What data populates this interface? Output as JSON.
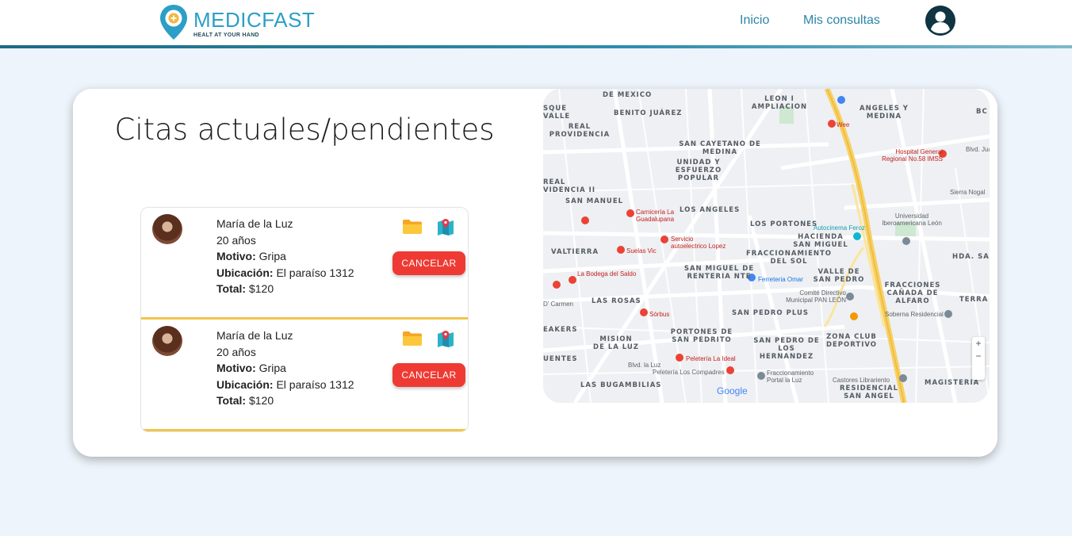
{
  "brand": {
    "name": "MEDICFAST",
    "tagline": "HEALT AT YOUR HAND",
    "accent": "#2b9fc6"
  },
  "nav": {
    "items": [
      {
        "label": "Inicio"
      },
      {
        "label": "Mis consultas"
      }
    ]
  },
  "page": {
    "title": "Citas actuales/pendientes"
  },
  "appointments": [
    {
      "name": "María de la Luz",
      "age": "20 años",
      "reason_label": "Motivo:",
      "reason": "Gripa",
      "location_label": "Ubicación:",
      "location": "El paraíso 1312",
      "total_label": "Total:",
      "total": "$120",
      "cancel_label": "CANCELAR"
    },
    {
      "name": "María de la Luz",
      "age": "20 años",
      "reason_label": "Motivo:",
      "reason": "Gripa",
      "location_label": "Ubicación:",
      "location": "El paraíso 1312",
      "total_label": "Total:",
      "total": "$120",
      "cancel_label": "CANCELAR"
    }
  ],
  "map": {
    "areas": [
      "DE MEXICO",
      "BENITO JUÁREZ",
      "LEON I AMPLIACION",
      "ANGELES Y MEDINA",
      "SQUE VALLE",
      "REAL PROVIDENCIA",
      "SAN CAYETANO DE MEDINA",
      "UNIDAD Y ESFUERZO POPULAR",
      "REAL VIDENCIA II",
      "SAN MANUEL",
      "LOS ANGELES",
      "LOS PORTONES",
      "HACIENDA SAN MIGUEL",
      "VALTIERRA",
      "FRACCIONAMIENTO DEL SOL",
      "HDA. SAN",
      "SAN MIGUEL DE RENTERIA NTE",
      "VALLE DE SAN PEDRO",
      "FRACCIONES CAÑADA DE ALFARO",
      "LAS ROSAS",
      "SAN PEDRO PLUS",
      "TERRA",
      "PORTONES DE SAN PEDRITO",
      "MISION DE LA LUZ",
      "SAN PEDRO DE LOS HERNANDEZ",
      "ZONA CLUB DEPORTIVO",
      "EAKERS",
      "UENTES",
      "LAS BUGAMBILIAS",
      "RESIDENCIAL SAN ANGEL",
      "MAGISTERIA",
      "BC"
    ],
    "pois": [
      "Wee",
      "Hospital General Regional No.58 IMSS",
      "Blvd. Juan",
      "Sierra Nogal",
      "Universidad Iberoamericana León",
      "Carnicería La Guadalupana",
      "Autocinema Feroz",
      "Servicio autoelectrico Lopez",
      "Suelas Vic",
      "La Bodega del Saldo",
      "Ferreteria Omar",
      "Comité Directivo Municipal PAN LEÓN",
      "Soberna Residencial",
      "Sórbus",
      "D' Carmen",
      "Peletería La Ideal",
      "Peletería Los Compadres",
      "Fraccionamiento Portal la Luz",
      "Castores Librariento",
      "Blvd. la Luz",
      "Google"
    ]
  }
}
